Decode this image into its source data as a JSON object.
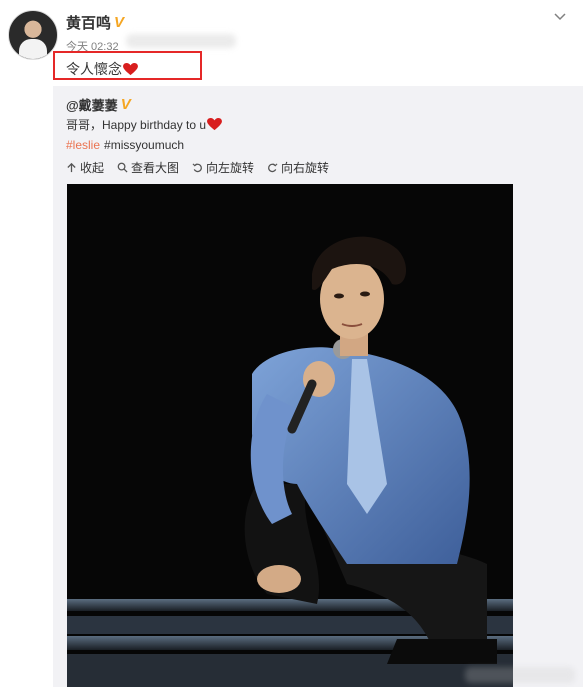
{
  "post": {
    "author": "黄百鸣",
    "verified_badge": "V",
    "time": "今天 02:32",
    "text": "令人懷念",
    "text_emoji": "heart-emoji"
  },
  "repost": {
    "author": "@戴萋萋",
    "verified_badge": "V",
    "text": "哥哥，Happy birthday to u",
    "text_emoji": "heart-emoji",
    "tags": [
      "#leslie",
      "#missyoumuch"
    ],
    "actions": {
      "collapse": "收起",
      "view_large": "查看大图",
      "rotate_left": "向左旋转",
      "rotate_right": "向右旋转"
    }
  },
  "colors": {
    "highlight": "#e52828",
    "tag": "#eb7350",
    "badge": "#f5a623"
  }
}
